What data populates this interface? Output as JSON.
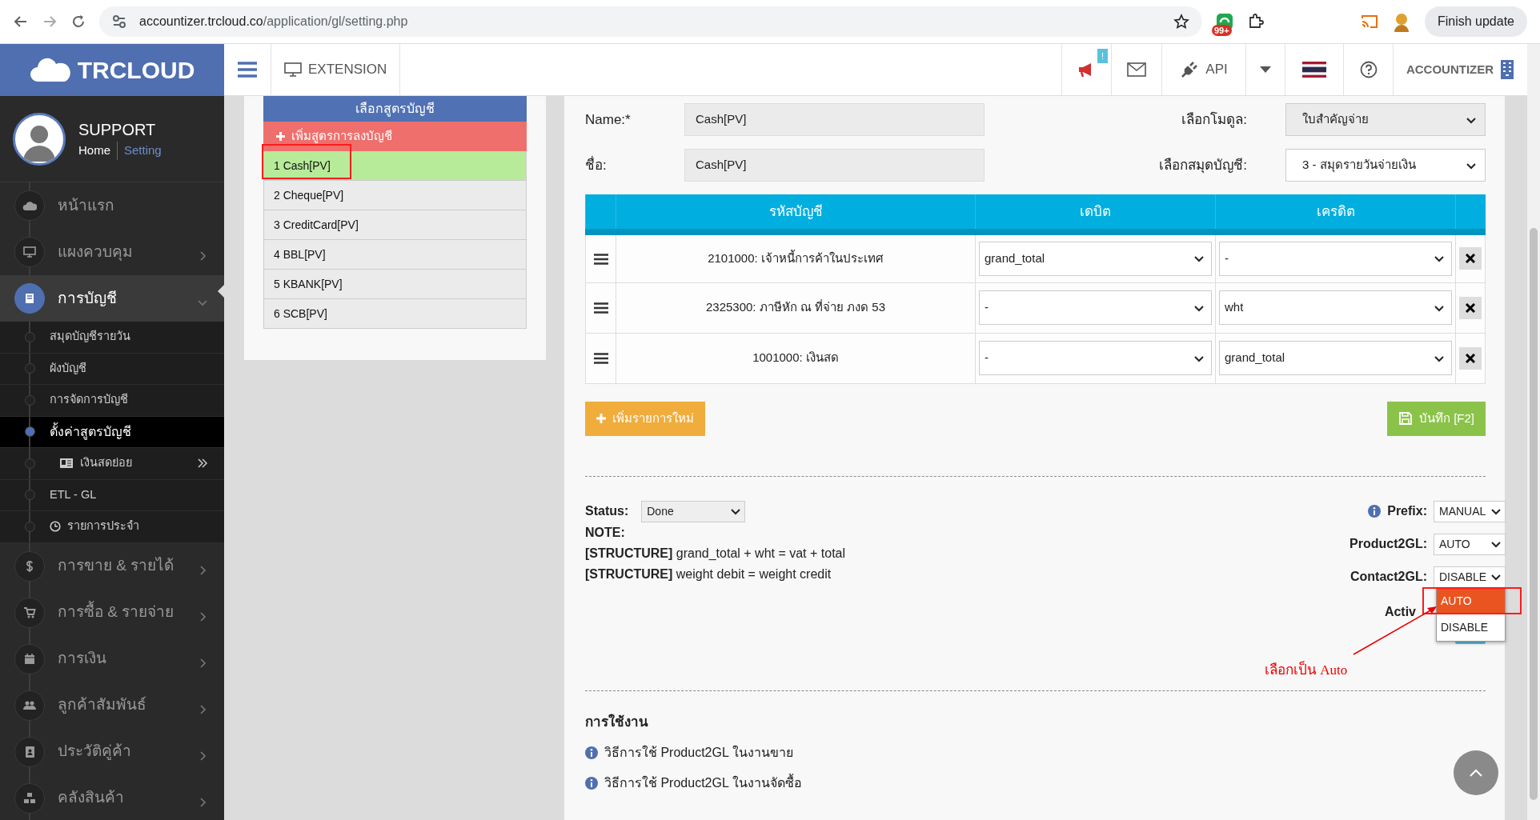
{
  "browser": {
    "url_host": "accountizer.trcloud.co",
    "url_path": "/application/gl/setting.php",
    "extension_badge": "99+",
    "update_button": "Finish update"
  },
  "header": {
    "logo": "TRCLOUD",
    "extension": "EXTENSION",
    "notification_badge": "!",
    "api": "API",
    "account": "ACCOUNTIZER"
  },
  "sidebar": {
    "user_name": "SUPPORT",
    "home_link": "Home",
    "setting_link": "Setting",
    "menu": [
      {
        "label": "หน้าแรก",
        "kind": "link",
        "selected": false
      },
      {
        "label": "แผงควบคุม",
        "kind": "group",
        "selected": false,
        "expanded": false
      },
      {
        "label": "การบัญชี",
        "kind": "group",
        "selected": true,
        "expanded": true,
        "children": [
          {
            "label": "สมุดบัญชีรายวัน",
            "selected": false
          },
          {
            "label": "ผังบัญชี",
            "selected": false
          },
          {
            "label": "การจัดการบัญชี",
            "selected": false
          },
          {
            "label": "ตั้งค่าสูตรบัญชี",
            "selected": true
          },
          {
            "label": "เงินสดย่อย",
            "selected": false
          },
          {
            "label": "ETL - GL",
            "selected": false
          },
          {
            "label": "รายการประจำ",
            "selected": false
          }
        ]
      },
      {
        "label": "การขาย & รายได้",
        "kind": "group",
        "selected": false,
        "expanded": false
      },
      {
        "label": "การซื้อ & รายจ่าย",
        "kind": "group",
        "selected": false,
        "expanded": false
      },
      {
        "label": "การเงิน",
        "kind": "group",
        "selected": false,
        "expanded": false
      },
      {
        "label": "ลูกค้าสัมพันธ์",
        "kind": "group",
        "selected": false,
        "expanded": false
      },
      {
        "label": "ประวัติคู่ค้า",
        "kind": "group",
        "selected": false,
        "expanded": false
      },
      {
        "label": "คลังสินค้า",
        "kind": "group",
        "selected": false,
        "expanded": false
      }
    ]
  },
  "formulas": {
    "title": "เลือกสูตรบัญชี",
    "add_label": "เพิ่มสูตรการลงบัญชี",
    "items": [
      {
        "label": "1 Cash[PV]",
        "selected": true
      },
      {
        "label": "2 Cheque[PV]",
        "selected": false
      },
      {
        "label": "3 CreditCard[PV]",
        "selected": false
      },
      {
        "label": "4 BBL[PV]",
        "selected": false
      },
      {
        "label": "5 KBANK[PV]",
        "selected": false
      },
      {
        "label": "6 SCB[PV]",
        "selected": false
      }
    ]
  },
  "form": {
    "name_label": "Name:*",
    "name_value": "Cash[PV]",
    "thai_name_label": "ชื่อ:",
    "thai_name_value": "Cash[PV]",
    "module_label": "เลือกโมดูล:",
    "module_value": "ใบสำคัญจ่าย",
    "journal_label": "เลือกสมุดบัญชี:",
    "journal_value": "3 - สมุดรายวันจ่ายเงิน"
  },
  "table": {
    "columns": [
      "รหัสบัญชี",
      "เดบิต",
      "เครดิต"
    ],
    "rows": [
      {
        "account": "2101000: เจ้าหนี้การค้าในประเทศ",
        "debit": "grand_total",
        "credit": "-"
      },
      {
        "account": "2325300: ภาษีหัก ณ ที่จ่าย ภงด 53",
        "debit": "-",
        "credit": "wht"
      },
      {
        "account": "1001000: เงินสด",
        "debit": "-",
        "credit": "grand_total"
      }
    ]
  },
  "add_button": "เพิ่มรายการใหม่",
  "save_button": "บันทึก [F2]",
  "status": {
    "label": "Status:",
    "value": "Done",
    "note_label": "NOTE:",
    "notes": [
      "**[STRUCTURE]** grand_total + wht = vat + total",
      "**[STRUCTURE]** weight debit = weight credit"
    ]
  },
  "settings": [
    {
      "label": "Prefix:",
      "value": "MANUAL",
      "info_icon": true
    },
    {
      "label": "Product2GL:",
      "value": "AUTO",
      "info_icon": false
    },
    {
      "label": "Contact2GL:",
      "value": "DISABLE",
      "info_icon": false
    }
  ],
  "dropdown": {
    "options": [
      {
        "label": "AUTO",
        "selected": true
      },
      {
        "label": "DISABLE",
        "selected": false
      }
    ]
  },
  "active_label": "Activ",
  "annotation": "เลือกเป็น Auto",
  "usage": {
    "title": "การใช้งาน",
    "links": [
      "วิธีการใช้ Product2GL ในงานขาย",
      "วิธีการใช้ Product2GL ในงานจัดซื้อ"
    ]
  }
}
